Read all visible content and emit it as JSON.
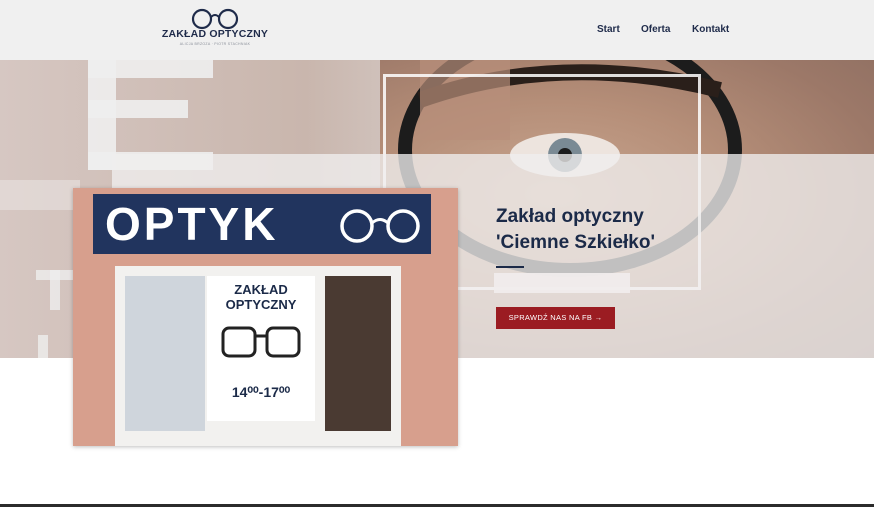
{
  "header": {
    "logo_name": "ZAKŁAD OPTYCZNY",
    "logo_tagline": "ALICJA BRZOZA · PIOTR STACHNIAK",
    "nav": [
      {
        "label": "Start"
      },
      {
        "label": "Oferta"
      },
      {
        "label": "Kontakt"
      }
    ]
  },
  "hero": {
    "title_line1": "Zakład optyczny",
    "title_line2": "'Ciemne Szkiełko'",
    "button_label": "SPRAWDŹ NAS NA FB"
  },
  "photo": {
    "sign_text": "OPTYK",
    "poster_title_line1": "ZAKŁAD",
    "poster_title_line2": "OPTYCZNY",
    "poster_hours": "14⁰⁰-17⁰⁰"
  },
  "colors": {
    "navy": "#1b2a48",
    "button": "#9b1c22",
    "header_bg": "#f0f0f0"
  },
  "icons": {
    "logo": "glasses-icon",
    "button": "arrow-right-icon"
  }
}
